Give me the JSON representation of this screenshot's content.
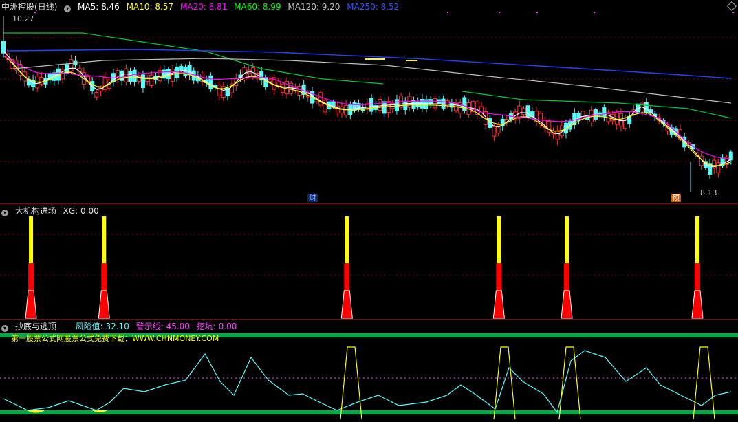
{
  "panel1": {
    "title": "中洲控股(日线)",
    "ma": [
      {
        "label": "MA5: 8.46",
        "color": "#ffffff"
      },
      {
        "label": "MA10: 8.57",
        "color": "#ffff00"
      },
      {
        "label": "MA20: 8.81",
        "color": "#ff00ff"
      },
      {
        "label": "MA60: 8.99",
        "color": "#00ff00"
      },
      {
        "label": "MA120: 9.20",
        "color": "#c0c0c0"
      },
      {
        "label": "MA250: 8.52",
        "color": "#3355ff"
      }
    ],
    "high_label": "10.27",
    "low_label": "8.13",
    "event_caibao": "财",
    "event_yu": "预"
  },
  "panel2": {
    "title": "大机构进场",
    "xg_label": "XG: 0.00",
    "signals": [
      0.042,
      0.141,
      0.47,
      0.676,
      0.768,
      0.945
    ]
  },
  "panel3": {
    "title": "抄底与逃顶",
    "risk_label": "风险值: 32.10",
    "warn_label": "警示线: 45.00",
    "dig_label": "挖坑: 0.00",
    "promo": "第一股票公式网股票公式免费下载：WWW.CHNMONEY.COM"
  },
  "colors": {
    "up": "#ff3333",
    "down": "#54ffff",
    "yellow": "#ffff00",
    "green": "#00aa44",
    "grid": "#8b0000"
  }
}
